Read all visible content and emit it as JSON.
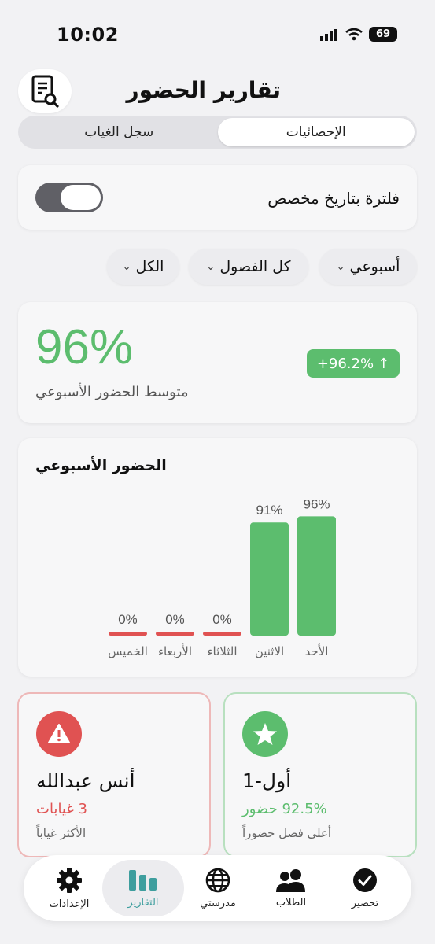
{
  "status_bar": {
    "time": "10:02",
    "battery": "69"
  },
  "header": {
    "title": "تقارير الحضور",
    "report_icon": "report-search-icon"
  },
  "segmented": {
    "items": [
      "الإحصائيات",
      "سجل الغياب"
    ],
    "selected": "الإحصائيات"
  },
  "filter": {
    "label": "فلترة بتاريخ مخصص",
    "toggle_on": false
  },
  "chips": {
    "period": "أسبوعي",
    "classes": "كل الفصول",
    "scope": "الكل"
  },
  "average": {
    "value": "96%",
    "label": "متوسط الحضور الأسبوعي",
    "trend": "+96.2%",
    "trend_icon": "arrow-up-icon"
  },
  "chart_data": {
    "type": "bar",
    "title": "الحضور الأسبوعي",
    "categories": [
      "الأحد",
      "الاثنين",
      "الثلاثاء",
      "الأربعاء",
      "الخميس"
    ],
    "values": [
      96,
      91,
      0,
      0,
      0
    ],
    "value_labels": [
      "96%",
      "91%",
      "0%",
      "0%",
      "0%"
    ],
    "unit": "%",
    "ylim": [
      0,
      100
    ],
    "colors": {
      "positive": "#5cbd6e",
      "zero": "#e05252"
    }
  },
  "top_class": {
    "name": "أول-1",
    "value": "92.5% حضور",
    "caption": "أعلى فصل حضوراً",
    "icon": "star-icon",
    "color": "#5cbd6e"
  },
  "top_absent": {
    "name": "أنس عبدالله",
    "value": "3 غيابات",
    "caption": "الأكثر غياباً",
    "icon": "warning-icon",
    "color": "#e05252"
  },
  "tab_bar": {
    "items": [
      {
        "label": "تحضير",
        "icon": "check-circle-icon"
      },
      {
        "label": "الطلاب",
        "icon": "people-icon"
      },
      {
        "label": "مدرستي",
        "icon": "globe-icon"
      },
      {
        "label": "التقارير",
        "icon": "bar-chart-icon"
      },
      {
        "label": "الإعدادات",
        "icon": "gear-icon"
      }
    ],
    "selected": "التقارير"
  },
  "colors": {
    "accent_green": "#5cbd6e",
    "accent_red": "#e05252",
    "tab_active": "#3e9e9e"
  }
}
